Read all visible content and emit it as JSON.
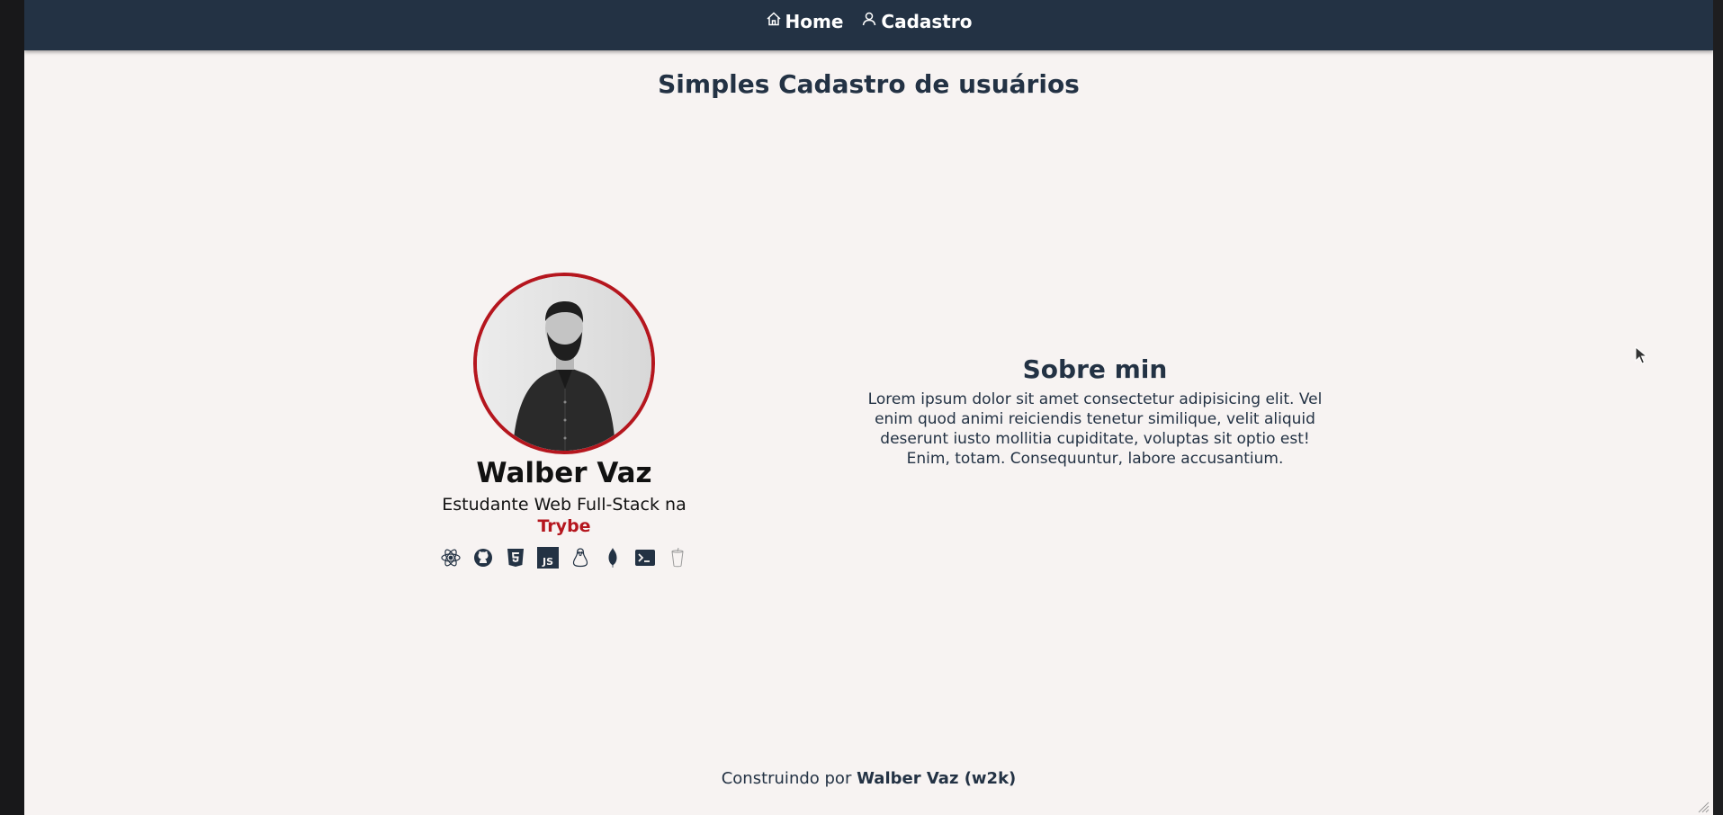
{
  "nav": {
    "items": [
      {
        "label": "Home",
        "icon": "home-icon"
      },
      {
        "label": "Cadastro",
        "icon": "user-icon"
      }
    ]
  },
  "page": {
    "title": "Simples Cadastro de usuários"
  },
  "profile": {
    "name": "Walber Vaz",
    "role": "Estudante Web Full-Stack na",
    "company": "Trybe",
    "tech_icons": [
      "react-icon",
      "github-icon",
      "html5-icon",
      "javascript-icon",
      "linux-icon",
      "mongodb-icon",
      "terminal-icon",
      "gulp-icon"
    ],
    "accent_color": "#b5161e"
  },
  "about": {
    "title": "Sobre min",
    "text": "Lorem ipsum dolor sit amet consectetur adipisicing elit. Vel enim quod animi reiciendis tenetur similique, velit aliquid deserunt iusto mollitia cupiditate, voluptas sit optio est! Enim, totam. Consequuntur, labore accusantium."
  },
  "footer": {
    "prefix": "Construindo por",
    "author": "Walber Vaz (w2k)"
  },
  "colors": {
    "navbar": "#233244",
    "background": "#f7f3f2",
    "text": "#233244"
  }
}
